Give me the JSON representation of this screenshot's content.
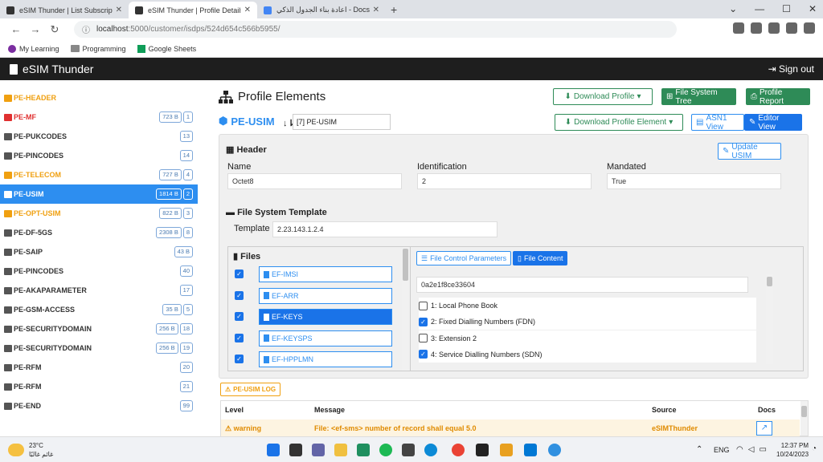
{
  "browser": {
    "tabs": [
      {
        "title": "eSIM Thunder | List Subscription",
        "active": false
      },
      {
        "title": "eSIM Thunder | Profile Details",
        "active": true
      },
      {
        "title": "اعادة بناء الجدول الذكي - Docs",
        "active": false
      }
    ],
    "url_host": "localhost",
    "url_path": ":5000/customer/isdps/524d654c566b5955/",
    "bookmarks": [
      "My Learning",
      "Programming",
      "Google Sheets"
    ]
  },
  "app": {
    "brand": "eSIM Thunder",
    "sign_out": "Sign out"
  },
  "sidebar": {
    "items": [
      {
        "label": "PE-HEADER",
        "color": "orange",
        "badges": []
      },
      {
        "label": "PE-MF",
        "color": "red",
        "badges": [
          "723 B",
          "1"
        ]
      },
      {
        "label": "PE-PUKCODES",
        "color": "default",
        "badges": [
          "13"
        ]
      },
      {
        "label": "PE-PINCODES",
        "color": "default",
        "badges": [
          "14"
        ]
      },
      {
        "label": "PE-TELECOM",
        "color": "orange",
        "badges": [
          "727 B",
          "4"
        ]
      },
      {
        "label": "PE-USIM",
        "color": "selected",
        "badges": [
          "1814 B",
          "2"
        ]
      },
      {
        "label": "PE-OPT-USIM",
        "color": "orange",
        "badges": [
          "822 B",
          "3"
        ]
      },
      {
        "label": "PE-DF-5GS",
        "color": "default",
        "badges": [
          "2308 B",
          "8"
        ]
      },
      {
        "label": "PE-SAIP",
        "color": "default",
        "badges": [
          "43 B"
        ]
      },
      {
        "label": "PE-PINCODES",
        "color": "default",
        "badges": [
          "40"
        ]
      },
      {
        "label": "PE-AKAPARAMETER",
        "color": "default",
        "badges": [
          "17"
        ]
      },
      {
        "label": "PE-GSM-ACCESS",
        "color": "default",
        "badges": [
          "35 B",
          "5"
        ]
      },
      {
        "label": "PE-SECURITYDOMAIN",
        "color": "default",
        "badges": [
          "256 B",
          "18"
        ]
      },
      {
        "label": "PE-SECURITYDOMAIN",
        "color": "default",
        "badges": [
          "256 B",
          "19"
        ]
      },
      {
        "label": "PE-RFM",
        "color": "default",
        "badges": [
          "20"
        ]
      },
      {
        "label": "PE-RFM",
        "color": "default",
        "badges": [
          "21"
        ]
      },
      {
        "label": "PE-END",
        "color": "default",
        "badges": [
          "99"
        ]
      }
    ]
  },
  "main": {
    "title": "Profile Elements",
    "download_profile": "Download Profile",
    "fs_tree": "File System Tree",
    "profile_report": "Profile Report",
    "pe_name": "PE-USIM",
    "pe_select": "[7] PE-USIM",
    "download_pe": "Download Profile Element",
    "asn1_view": "ASN1 View",
    "editor_view": "Editor View",
    "header_label": "Header",
    "update_usim": "Update USIM",
    "name_label": "Name",
    "name_value": "Octet8",
    "ident_label": "Identification",
    "ident_value": "2",
    "mandated_label": "Mandated",
    "mandated_value": "True",
    "fst_label": "File System Template",
    "template_label": "Template",
    "template_value": "2.23.143.1.2.4",
    "files_label": "Files",
    "files": [
      "EF-IMSI",
      "EF-ARR",
      "EF-KEYS",
      "EF-KEYSPS",
      "EF-HPPLMN"
    ],
    "fcp_tab": "File Control Parameters",
    "fc_tab": "File Content",
    "content_value": "0a2e1f8ce33604",
    "services": [
      {
        "label": "1: Local Phone Book",
        "checked": false
      },
      {
        "label": "2: Fixed Dialling Numbers (FDN)",
        "checked": true
      },
      {
        "label": "3: Extension 2",
        "checked": false
      },
      {
        "label": "4: Service Dialling Numbers (SDN)",
        "checked": true
      }
    ],
    "log_btn": "PE-USIM LOG",
    "log_headers": {
      "level": "Level",
      "message": "Message",
      "source": "Source",
      "docs": "Docs"
    },
    "log_row": {
      "level": "warning",
      "message": "File: <ef-sms> number of record shall equal 5.0",
      "source": "eSIMThunder"
    }
  },
  "taskbar": {
    "weather_temp": "23°C",
    "weather_text": "غائم غالبًا",
    "lang": "ENG",
    "time": "12:37 PM",
    "date": "10/24/2023"
  }
}
